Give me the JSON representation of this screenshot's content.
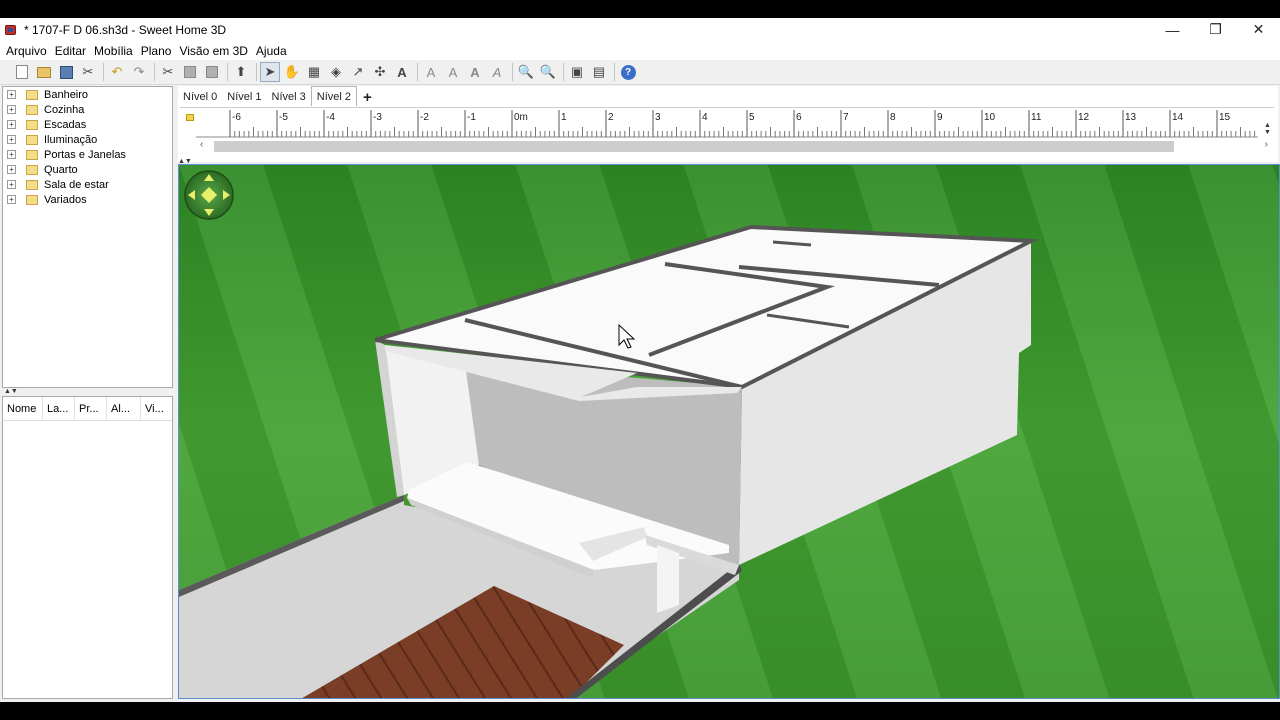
{
  "window": {
    "title": "* 1707-F D 06.sh3d - Sweet Home 3D",
    "controls": {
      "minimize": "—",
      "restore": "❐",
      "close": "✕"
    }
  },
  "menu": [
    "Arquivo",
    "Editar",
    "Mobília",
    "Plano",
    "Visão em 3D",
    "Ajuda"
  ],
  "toolbar": {
    "icons": [
      "new-icon",
      "open-icon",
      "save-icon",
      "cut-tool-icon",
      "undo-icon",
      "redo-icon",
      "cut-icon",
      "copy-icon",
      "paste-icon",
      "add-furniture-icon",
      "select-icon",
      "pan-icon",
      "create-walls-icon",
      "create-rooms-icon",
      "create-polylines-icon",
      "create-dimensions-icon",
      "add-text-icon",
      "text-style-1-icon",
      "text-style-2-icon",
      "text-style-3-icon",
      "text-style-4-icon",
      "zoom-in-icon",
      "zoom-out-icon",
      "create-photo-icon",
      "create-video-icon",
      "help-icon"
    ],
    "help_glyph": "?"
  },
  "catalog": {
    "categories": [
      "Banheiro",
      "Cozinha",
      "Escadas",
      "Iluminação",
      "Portas e Janelas",
      "Quarto",
      "Sala de estar",
      "Variados"
    ],
    "expand_glyph": "+"
  },
  "furniture_table": {
    "columns": [
      "Nome",
      "La...",
      "Pr...",
      "Al...",
      "Vi..."
    ]
  },
  "plan": {
    "levels": [
      "Nível 0",
      "Nível 1",
      "Nível 3",
      "Nível 2"
    ],
    "selected_level": "Nível 2",
    "add_level": "+",
    "ruler_labels": [
      "-6",
      "-5",
      "-4",
      "-3",
      "-2",
      "-1",
      "0m",
      "1",
      "2",
      "3",
      "4",
      "5",
      "6",
      "7",
      "8",
      "9",
      "10",
      "11",
      "12",
      "13",
      "14",
      "15"
    ]
  },
  "view3d": {
    "navigation": "navigation-arrows-icon",
    "colors": {
      "grass": "#3f9a2e",
      "wall": "#e6e6e6",
      "roof": "#fafafa",
      "deck": "#7a3d26"
    }
  }
}
